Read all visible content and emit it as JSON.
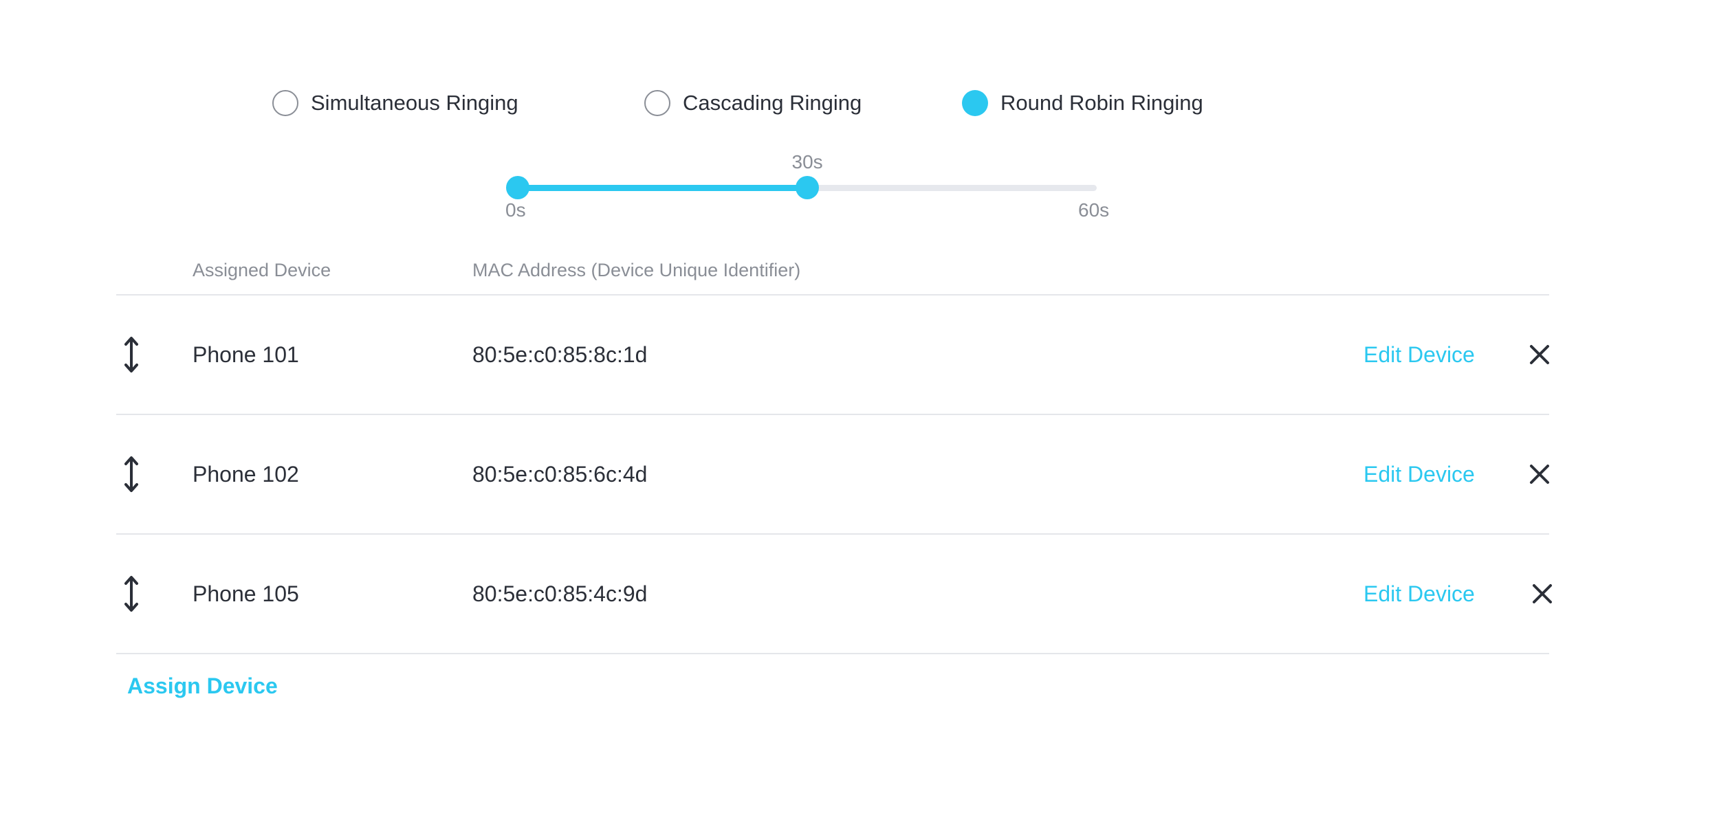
{
  "ringing_modes": {
    "options": [
      {
        "label": "Simultaneous Ringing",
        "selected": false
      },
      {
        "label": "Cascading Ringing",
        "selected": false
      },
      {
        "label": "Round Robin Ringing",
        "selected": true
      }
    ]
  },
  "slider": {
    "min_label": "0s",
    "max_label": "60s",
    "value_label": "30s",
    "min": 0,
    "max": 60,
    "range": [
      0,
      30
    ],
    "unit": "s"
  },
  "table": {
    "headers": {
      "device": "Assigned Device",
      "mac": "MAC Address (Device Unique Identifier)"
    },
    "rows": [
      {
        "device": "Phone 101",
        "mac": "80:5e:c0:85:8c:1d",
        "edit_label": "Edit Device"
      },
      {
        "device": "Phone 102",
        "mac": "80:5e:c0:85:6c:4d",
        "edit_label": "Edit Device"
      },
      {
        "device": "Phone 105",
        "mac": "80:5e:c0:85:4c:9d",
        "edit_label": "Edit Device"
      }
    ]
  },
  "actions": {
    "assign_label": "Assign Device"
  },
  "icons": {
    "drag": "vertical-arrows-icon",
    "remove": "close-icon"
  },
  "colors": {
    "accent": "#2bc8f0",
    "text": "#2b2f38",
    "muted": "#8a8e96",
    "track": "#e6e8ed",
    "divider": "#e4e6ea"
  }
}
